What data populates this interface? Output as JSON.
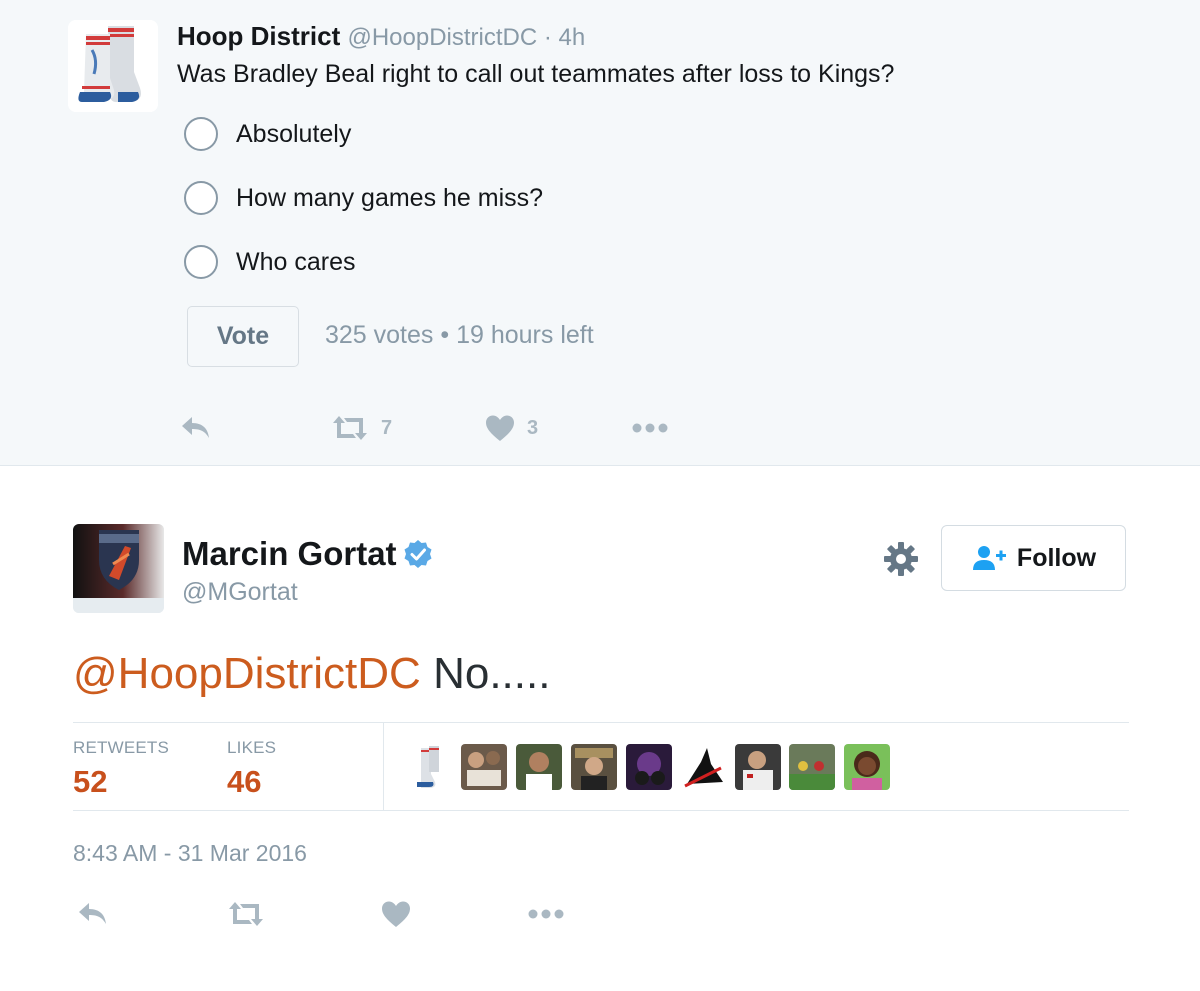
{
  "quoted_tweet": {
    "author_name": "Hoop District",
    "author_handle": "@HoopDistrictDC",
    "time_ago": "4h",
    "separator": " · ",
    "text": "Was Bradley Beal right to call out teammates after loss to Kings?",
    "poll": {
      "options": [
        "Absolutely",
        "How many games he miss?",
        "Who cares"
      ],
      "vote_label": "Vote",
      "votes": "325 votes",
      "dot": " • ",
      "time_left": "19 hours left"
    },
    "actions": {
      "reply_icon": "reply-icon",
      "retweet_icon": "retweet-icon",
      "retweet_count": "7",
      "like_icon": "heart-icon",
      "like_count": "3",
      "more_icon": "more-icon"
    }
  },
  "main_tweet": {
    "author_name": "Marcin Gortat",
    "author_handle": "@MGortat",
    "verified": true,
    "follow_label": "Follow",
    "mention": "@HoopDistrictDC",
    "text": " No.....",
    "stats": {
      "retweets_label": "RETWEETS",
      "retweets_value": "52",
      "likes_label": "LIKES",
      "likes_value": "46"
    },
    "timestamp": "8:43 AM - 31 Mar 2016"
  },
  "colors": {
    "accent": "#1da1f2",
    "mention": "#cc5c1e",
    "stat_value": "#c8501c",
    "muted": "#8899a6",
    "quoted_bg": "#f5f8fa"
  }
}
